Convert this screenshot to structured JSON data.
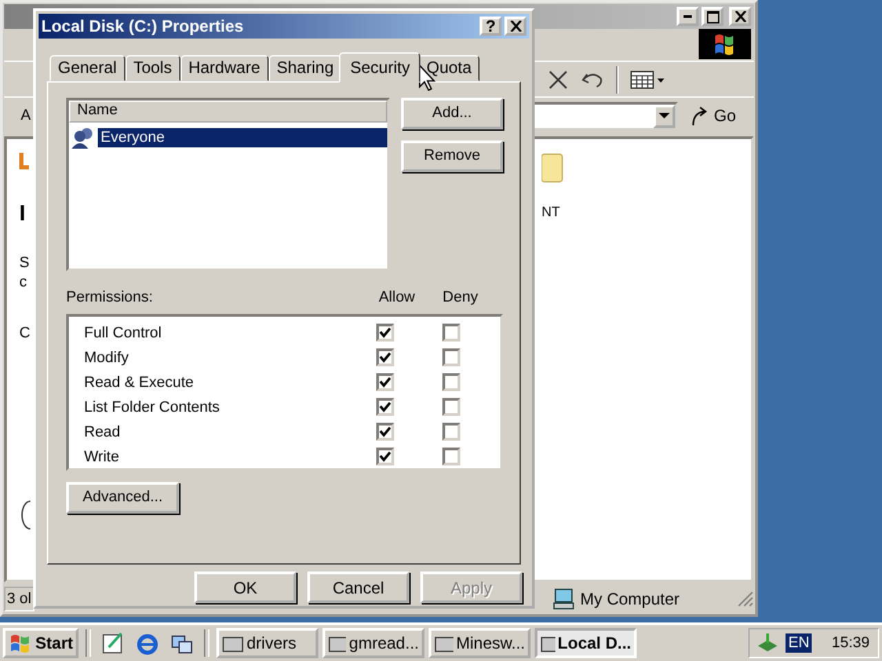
{
  "explorer": {
    "address_label": "A",
    "left_fragments": [
      {
        "text": "I",
        "bold": true
      },
      {
        "text": "S",
        "bold": false
      },
      {
        "text": "c",
        "bold": false
      },
      {
        "text": "C",
        "bold": false
      }
    ],
    "folder_label": "NT",
    "go_button": "Go",
    "status_left": "3 ol",
    "status_right": "My Computer"
  },
  "dialog": {
    "title": "Local Disk (C:) Properties",
    "help_button": "?",
    "tabs": [
      {
        "label": "General",
        "selected": false
      },
      {
        "label": "Tools",
        "selected": false
      },
      {
        "label": "Hardware",
        "selected": false
      },
      {
        "label": "Sharing",
        "selected": false
      },
      {
        "label": "Security",
        "selected": true
      },
      {
        "label": "Quota",
        "selected": false
      }
    ],
    "list_header": "Name",
    "principals": [
      {
        "name": "Everyone",
        "selected": true
      }
    ],
    "side_buttons": [
      "Add...",
      "Remove"
    ],
    "permissions_label": "Permissions:",
    "allow_header": "Allow",
    "deny_header": "Deny",
    "permissions": [
      {
        "name": "Full Control",
        "allow": true,
        "deny": false
      },
      {
        "name": "Modify",
        "allow": true,
        "deny": false
      },
      {
        "name": "Read & Execute",
        "allow": true,
        "deny": false
      },
      {
        "name": "List Folder Contents",
        "allow": true,
        "deny": false
      },
      {
        "name": "Read",
        "allow": true,
        "deny": false
      },
      {
        "name": "Write",
        "allow": true,
        "deny": false
      }
    ],
    "advanced_button": "Advanced...",
    "footer_buttons": [
      {
        "label": "OK",
        "disabled": false
      },
      {
        "label": "Cancel",
        "disabled": false
      },
      {
        "label": "Apply",
        "disabled": true
      }
    ]
  },
  "taskbar": {
    "start": "Start",
    "tasks": [
      {
        "label": "drivers",
        "selected": false
      },
      {
        "label": "gmread...",
        "selected": false
      },
      {
        "label": "Minesw...",
        "selected": false
      },
      {
        "label": "Local D...",
        "selected": true
      }
    ],
    "language": "EN",
    "clock": "15:39"
  }
}
